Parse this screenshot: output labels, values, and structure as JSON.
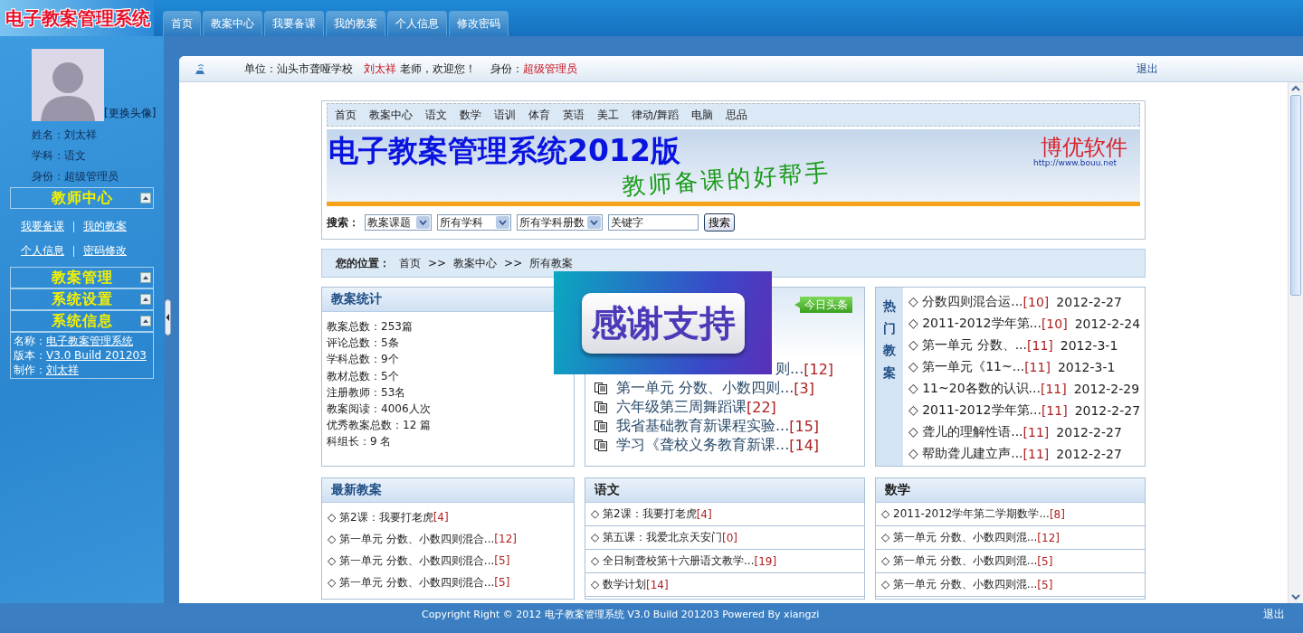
{
  "logo": "电子教案管理系统",
  "nav_tabs": [
    {
      "label": "首页",
      "selected": false
    },
    {
      "label": "教案中心",
      "selected": false
    },
    {
      "label": "我要备课",
      "selected": false
    },
    {
      "label": "我的教案",
      "selected": false
    },
    {
      "label": "个人信息",
      "selected": false
    },
    {
      "label": "修改密码",
      "selected": false
    }
  ],
  "sidebar": {
    "change_avatar": "[更换头像]",
    "profile": [
      "姓名：刘太祥",
      "学科：语文",
      "身份：超级管理员"
    ],
    "sections": [
      {
        "title": "教师中心",
        "kind": "links",
        "links": [
          [
            "我要备课",
            "我的教案"
          ],
          [
            "个人信息",
            "密码修改"
          ]
        ]
      },
      {
        "title": "教案管理",
        "kind": "empty"
      },
      {
        "title": "系统设置",
        "kind": "empty"
      },
      {
        "title": "系统信息",
        "kind": "info",
        "rows": [
          {
            "label": "名称：",
            "value": "电子教案管理系统"
          },
          {
            "label": "版本：",
            "value": "V3.0 Build 201203"
          },
          {
            "label": "制作：",
            "value": "刘太祥"
          }
        ]
      }
    ]
  },
  "info_bar": {
    "unit_label": "单位：",
    "unit": "汕头市聋哑学校",
    "user": "刘太祥",
    "greeting": "老师，欢迎您！",
    "role_label": "身份：",
    "role": "超级管理员",
    "logout": "退出"
  },
  "site_menu": [
    "首页",
    "教案中心",
    "语文",
    "数学",
    "语训",
    "体育",
    "英语",
    "美工",
    "律动/舞蹈",
    "电脑",
    "思品"
  ],
  "banner": {
    "title": "电子教案管理系统2012版",
    "slogan": "教师备课的好帮手",
    "brand": "博优软件",
    "url": "http://www.bouu.net"
  },
  "search": {
    "label": "搜索：",
    "selects": [
      "教案课题",
      "所有学科",
      "所有学科册数"
    ],
    "keyword": "关键字",
    "button": "搜索"
  },
  "breadcrumb": {
    "label": "您的位置：",
    "items": [
      "首页",
      ">>",
      "教案中心",
      ">>",
      "所有教案"
    ]
  },
  "stats": {
    "title": "教案统计",
    "lines": [
      "教案总数：253篇",
      "评论总数：5条",
      "学科总数：9个",
      "教材总数：5个",
      "注册教师：53名",
      "教案阅读：4006人次",
      "优秀教案总数：12 篇",
      "科组长：9 名"
    ]
  },
  "news": {
    "badge": "今日头条",
    "covered_item": {
      "title": "则...",
      "count": "[12]"
    },
    "items": [
      {
        "title": "第一单元 分数、小数四则...",
        "count": "[3]"
      },
      {
        "title": "六年级第三周舞蹈课",
        "count": "[22]"
      },
      {
        "title": "我省基础教育新课程实验...",
        "count": "[15]"
      },
      {
        "title": "学习《聋校义务教育新课...",
        "count": "[14]"
      }
    ]
  },
  "hot": {
    "title": "热门教案",
    "items": [
      {
        "text": "◇ 分数四则混合运...",
        "count": "[10]",
        "date": "2012-2-27"
      },
      {
        "text": "◇ 2011-2012学年第...",
        "count": "[10]",
        "date": "2012-2-24"
      },
      {
        "text": "◇ 第一单元 分数、...",
        "count": "[11]",
        "date": "2012-3-1"
      },
      {
        "text": "◇ 第一单元《11~...",
        "count": "[11]",
        "date": "2012-3-1"
      },
      {
        "text": "◇ 11~20各数的认识...",
        "count": "[11]",
        "date": "2012-2-29"
      },
      {
        "text": "◇ 2011-2012学年第...",
        "count": "[11]",
        "date": "2012-2-27"
      },
      {
        "text": "◇ 聋儿的理解性语...",
        "count": "[11]",
        "date": "2012-2-27"
      },
      {
        "text": "◇ 帮助聋儿建立声...",
        "count": "[11]",
        "date": "2012-2-27"
      }
    ]
  },
  "list_panels": [
    {
      "title": "最新教案",
      "kind": "plain",
      "items": [
        {
          "text": "◇ 第2课：我要打老虎",
          "count": "[4]"
        },
        {
          "text": "◇ 第一单元 分数、小数四则混合...",
          "count": "[12]"
        },
        {
          "text": "◇ 第一单元 分数、小数四则混合...",
          "count": "[5]"
        },
        {
          "text": "◇ 第一单元 分数、小数四则混合...",
          "count": "[5]"
        }
      ]
    },
    {
      "title": "语文",
      "kind": "ruled",
      "items": [
        {
          "text": "◇ 第2课：我要打老虎",
          "count": "[4]"
        },
        {
          "text": "◇ 第五课：我爱北京天安门",
          "count": "[0]"
        },
        {
          "text": "◇ 全日制聋校第十六册语文教学...",
          "count": "[19]"
        },
        {
          "text": "◇ 数学计划",
          "count": "[14]"
        }
      ]
    },
    {
      "title": "数学",
      "kind": "ruled",
      "items": [
        {
          "text": "◇ 2011-2012学年第二学期数学...",
          "count": "[8]"
        },
        {
          "text": "◇ 第一单元 分数、小数四则混...",
          "count": "[12]"
        },
        {
          "text": "◇ 第一单元 分数、小数四则混...",
          "count": "[5]"
        },
        {
          "text": "◇ 第一单元 分数、小数四则混...",
          "count": "[5]"
        }
      ]
    }
  ],
  "thanks_popup": "感谢支持",
  "footer": {
    "copyright": "Copyright Right © 2012  电子教案管理系统 V3.0 Build 201203  Powered By xiangzi",
    "logout": "退出"
  }
}
